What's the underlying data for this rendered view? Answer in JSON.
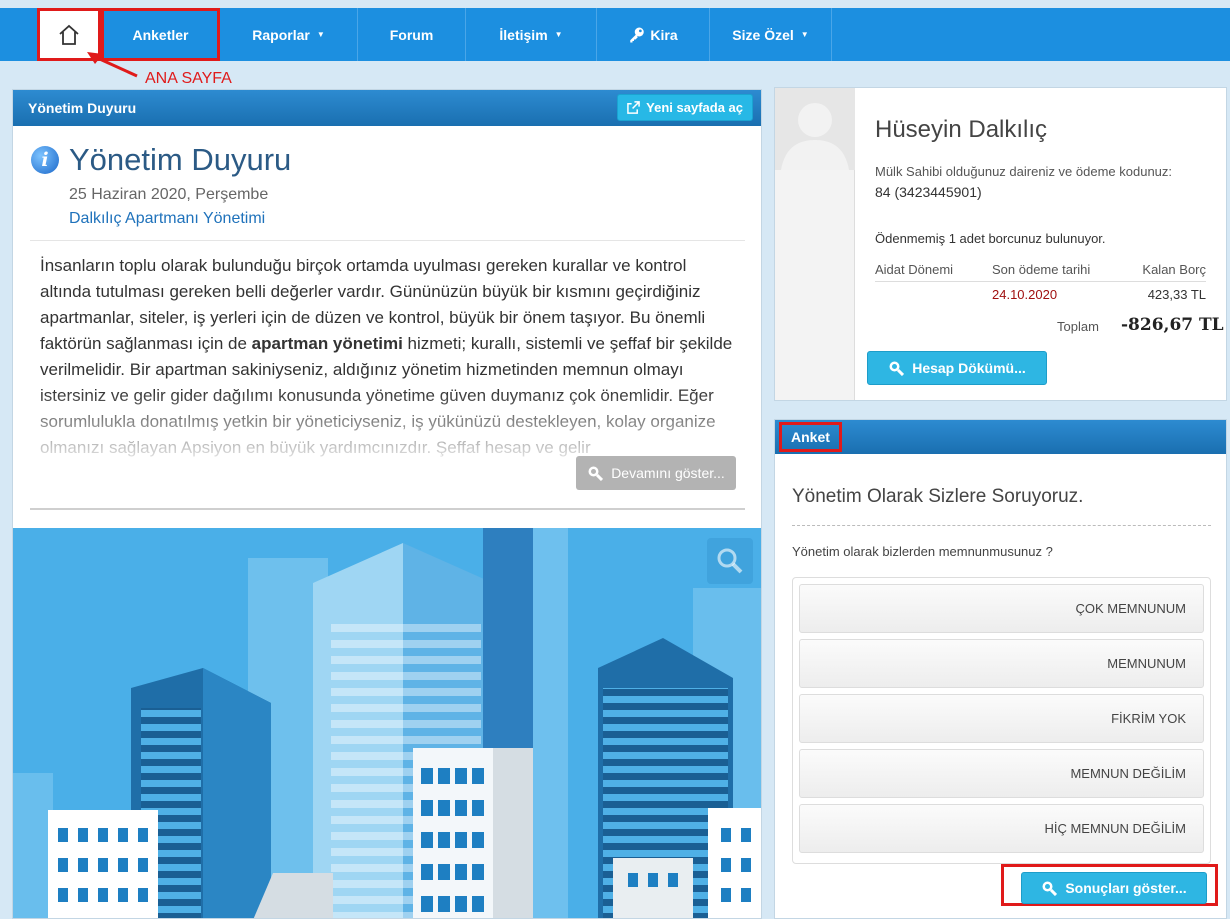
{
  "nav": {
    "items": [
      {
        "label": "Anketler"
      },
      {
        "label": "Raporlar"
      },
      {
        "label": "Forum"
      },
      {
        "label": "İletişim"
      },
      {
        "label": "Kira"
      },
      {
        "label": "Size Özel"
      }
    ]
  },
  "annotation": {
    "home_label": "ANA SAYFA"
  },
  "announcement": {
    "panel_title": "Yönetim Duyuru",
    "new_page_button": "Yeni sayfada aç",
    "title": "Yönetim Duyuru",
    "date": "25 Haziran 2020, Perşembe",
    "author": "Dalkılıç Apartmanı Yönetimi",
    "body_part1": "İnsanların toplu olarak bulunduğu birçok ortamda uyulması gereken kurallar ve kontrol altında tutulması gereken belli değerler vardır. Gününüzün büyük bir kısmını geçirdiğiniz apartmanlar, siteler, iş yerleri için de düzen ve kontrol, büyük bir önem taşıyor. Bu önemli faktörün sağlanması için de ",
    "body_bold": "apartman yönetimi",
    "body_part2": " hizmeti; kurallı, sistemli ve şeffaf bir şekilde verilmelidir. Bir apartman sakiniyseniz, aldığınız yönetim hizmetinden memnun olmayı istersiniz ve gelir gider dağılımı konusunda yönetime güven duymanız çok önemlidir. Eğer sorumlulukla donatılmış yetkin bir yöneticiyseniz, iş yükünüzü destekleyen, kolay organize olmanızı sağlayan Apsiyon en büyük yardımcınızdır. Şeffaf hesap ve gelir",
    "more_button": "Devamını göster..."
  },
  "profile": {
    "name": "Hüseyin Dalkılıç",
    "description": "Mülk Sahibi olduğunuz daireniz ve ödeme kodunuz:",
    "code": "84 (3423445901)",
    "debt_notice": "Ödenmemiş 1 adet borcunuz bulunuyor.",
    "table_headers": [
      "Aidat Dönemi",
      "Son ödeme tarihi",
      "Kalan Borç"
    ],
    "rows": [
      {
        "period": "",
        "due_date": "24.10.2020",
        "remaining": "423,33 TL"
      }
    ],
    "total_label": "Toplam",
    "total_value": "-826,67 TL",
    "statement_button": "Hesap Dökümü..."
  },
  "poll": {
    "panel_title": "Anket",
    "title": "Yönetim Olarak Sizlere Soruyoruz.",
    "question": "Yönetim olarak bizlerden memnunmusunuz ?",
    "options": [
      "ÇOK MEMNUNUM",
      "MEMNUNUM",
      "FİKRİM YOK",
      "MEMNUN DEĞİLİM",
      "HİÇ MEMNUN DEĞİLİM"
    ],
    "results_button": "Sonuçları göster..."
  },
  "colors": {
    "nav_blue": "#1c8fe0",
    "accent_cyan": "#2eb6e3",
    "highlight_red": "#e01a1a"
  }
}
